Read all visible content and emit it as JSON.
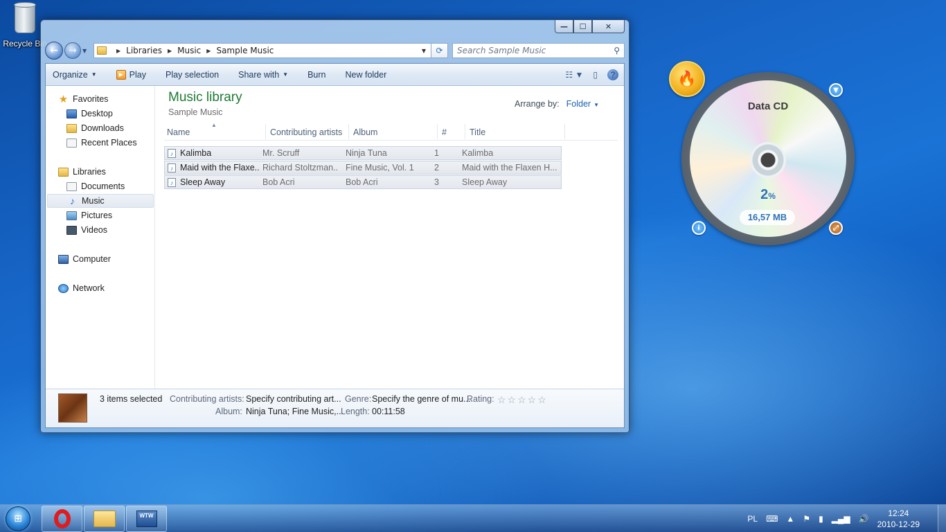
{
  "desktop": {
    "recycle_bin_label": "Recycle Bin"
  },
  "window": {
    "caption_buttons": {
      "minimize": "—",
      "maximize": "☐",
      "close": "✕"
    },
    "address": [
      "Libraries",
      "Music",
      "Sample Music"
    ],
    "search_placeholder": "Search Sample Music",
    "commands": {
      "organize": "Organize",
      "play": "Play",
      "play_selection": "Play selection",
      "share_with": "Share with",
      "burn": "Burn",
      "new_folder": "New folder"
    },
    "nav": {
      "favorites": "Favorites",
      "desktop": "Desktop",
      "downloads": "Downloads",
      "recent_places": "Recent Places",
      "libraries": "Libraries",
      "documents": "Documents",
      "music": "Music",
      "pictures": "Pictures",
      "videos": "Videos",
      "computer": "Computer",
      "network": "Network"
    },
    "library_title": "Music library",
    "library_subtitle": "Sample Music",
    "arrange_label": "Arrange by:",
    "arrange_value": "Folder",
    "columns": [
      "Name",
      "Contributing artists",
      "Album",
      "#",
      "Title"
    ],
    "rows": [
      {
        "name": "Kalimba",
        "artists": "Mr. Scruff",
        "album": "Ninja Tuna",
        "num": "1",
        "title": "Kalimba"
      },
      {
        "name": "Maid with the Flaxe...",
        "artists": "Richard Stoltzman...",
        "album": "Fine Music, Vol. 1",
        "num": "2",
        "title": "Maid with the Flaxen H..."
      },
      {
        "name": "Sleep Away",
        "artists": "Bob Acri",
        "album": "Bob Acri",
        "num": "3",
        "title": "Sleep Away"
      }
    ],
    "details": {
      "count": "3 items selected",
      "artists_label": "Contributing artists:",
      "artists_value": "Specify contributing art...",
      "genre_label": "Genre:",
      "genre_value": "Specify the genre of mu...",
      "rating_label": "Rating:",
      "rating_stars": "☆☆☆☆☆",
      "album_label": "Album:",
      "album_value": "Ninja Tuna; Fine Music,...",
      "length_label": "Length:",
      "length_value": "00:11:58"
    }
  },
  "gadget": {
    "title": "Data CD",
    "percent": "2",
    "percent_unit": "%",
    "size": "16,57 MB"
  },
  "taskbar": {
    "wtw_label": "WTW",
    "lang": "PL",
    "time": "12:24",
    "date": "2010-12-29"
  }
}
